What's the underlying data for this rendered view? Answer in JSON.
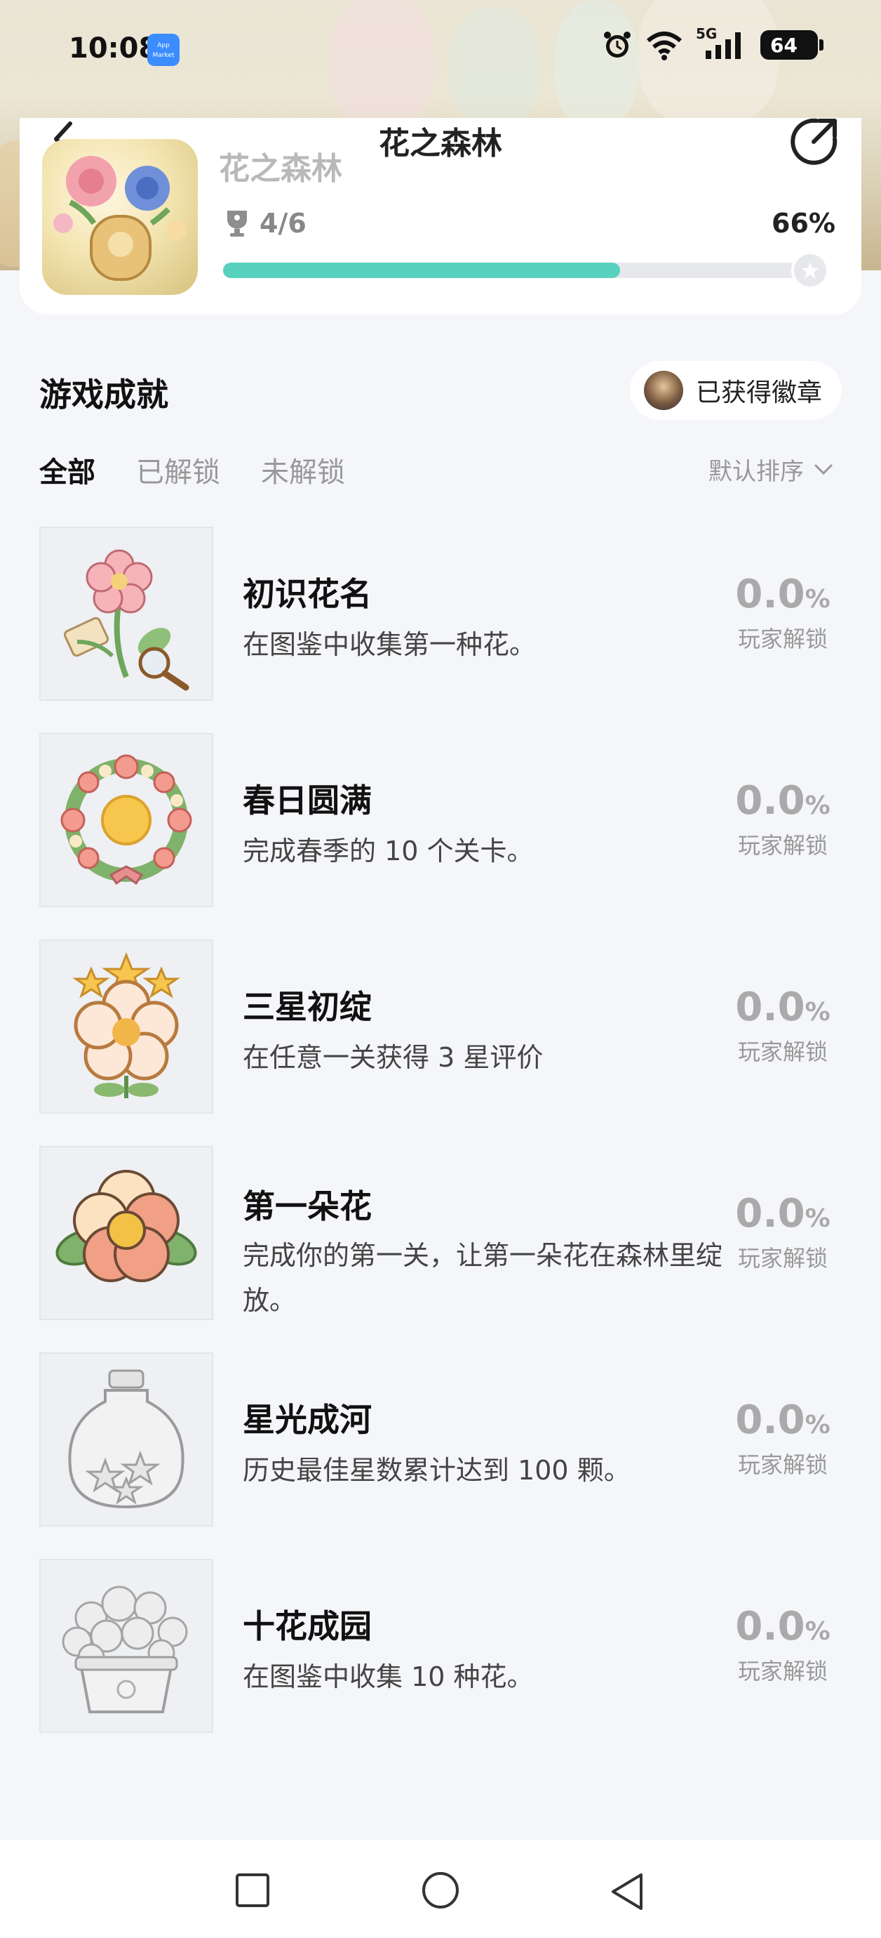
{
  "status_bar": {
    "time": "10:08",
    "app_badge": "App Market",
    "network": "5G",
    "battery": "64"
  },
  "header": {
    "title": "花之森林",
    "game_name": "花之森林",
    "trophies": "4/6",
    "percent_label": "66%",
    "progress": 0.66
  },
  "section": {
    "title": "游戏成就",
    "badge_button": "已获得徽章"
  },
  "tabs": [
    {
      "label": "全部",
      "active": true
    },
    {
      "label": "已解锁",
      "active": false
    },
    {
      "label": "未解锁",
      "active": false
    }
  ],
  "sort_label": "默认排序",
  "achievements": [
    {
      "title": "初识花名",
      "desc": "在图鉴中收集第一种花。",
      "value": "0.0",
      "unit": "%",
      "caption": "玩家解锁",
      "icon": "flower-magnifier-icon"
    },
    {
      "title": "春日圆满",
      "desc": "完成春季的 10 个关卡。",
      "value": "0.0",
      "unit": "%",
      "caption": "玩家解锁",
      "icon": "spring-wreath-icon"
    },
    {
      "title": "三星初绽",
      "desc": "在任意一关获得 3 星评价",
      "value": "0.0",
      "unit": "%",
      "caption": "玩家解锁",
      "icon": "three-star-flower-icon"
    },
    {
      "title": "第一朵花",
      "desc": "完成你的第一关，让第一朵花在森林里绽放。",
      "value": "0.0",
      "unit": "%",
      "caption": "玩家解锁",
      "icon": "first-flower-icon"
    },
    {
      "title": "星光成河",
      "desc": "历史最佳星数累计达到 100 颗。",
      "value": "0.0",
      "unit": "%",
      "caption": "玩家解锁",
      "icon": "star-jar-icon"
    },
    {
      "title": "十花成园",
      "desc": "在图鉴中收集 10 种花。",
      "value": "0.0",
      "unit": "%",
      "caption": "玩家解锁",
      "icon": "flower-pot-icon"
    }
  ],
  "colors": {
    "accent": "#58d1bf",
    "background": "#f5f6f9"
  }
}
